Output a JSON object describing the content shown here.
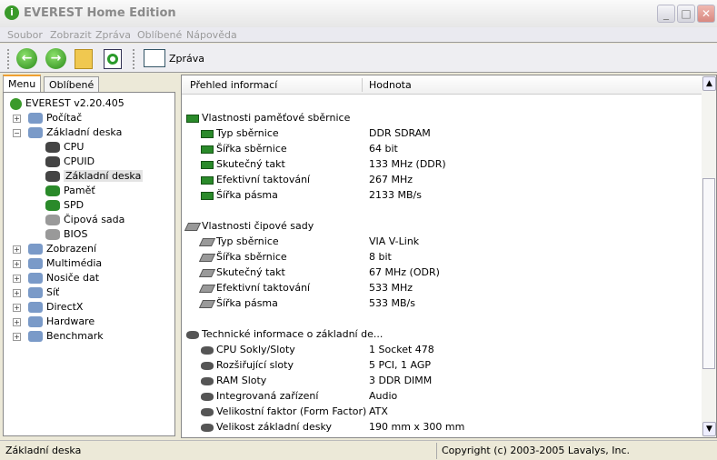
{
  "window": {
    "title": "EVEREST Home Edition",
    "minimize": "_",
    "maximize": "□",
    "close": "✕"
  },
  "menu": [
    "Soubor",
    "Zobrazit",
    "Zpráva",
    "Oblíbené",
    "Nápověda"
  ],
  "toolbar": {
    "back": "←",
    "forward": "→",
    "report_label": "Zpráva"
  },
  "tabs": [
    "Menu",
    "Oblíbené"
  ],
  "tree": {
    "root": "EVEREST v2.20.405",
    "items": [
      {
        "label": "Počítač",
        "level": 1,
        "exp": "+"
      },
      {
        "label": "Základní deska",
        "level": 1,
        "exp": "−"
      },
      {
        "label": "CPU",
        "level": 2
      },
      {
        "label": "CPUID",
        "level": 2
      },
      {
        "label": "Základní deska",
        "level": 2,
        "selected": true
      },
      {
        "label": "Paměť",
        "level": 2
      },
      {
        "label": "SPD",
        "level": 2
      },
      {
        "label": "Čipová sada",
        "level": 2
      },
      {
        "label": "BIOS",
        "level": 2
      },
      {
        "label": "Zobrazení",
        "level": 1,
        "exp": "+"
      },
      {
        "label": "Multimédia",
        "level": 1,
        "exp": "+"
      },
      {
        "label": "Nosiče dat",
        "level": 1,
        "exp": "+"
      },
      {
        "label": "Síť",
        "level": 1,
        "exp": "+"
      },
      {
        "label": "DirectX",
        "level": 1,
        "exp": "+"
      },
      {
        "label": "Hardware",
        "level": 1,
        "exp": "+"
      },
      {
        "label": "Benchmark",
        "level": 1,
        "exp": "+"
      }
    ]
  },
  "columns": [
    "Přehled informací",
    "Hodnota"
  ],
  "groups": [
    {
      "title": "Vlastnosti paměťové sběrnice",
      "icon": "mem",
      "rows": [
        [
          "Typ sběrnice",
          "DDR SDRAM"
        ],
        [
          "Šířka sběrnice",
          "64 bit"
        ],
        [
          "Skutečný takt",
          "133 MHz (DDR)"
        ],
        [
          "Efektivní taktování",
          "267 MHz"
        ],
        [
          "Šířka pásma",
          "2133 MB/s"
        ]
      ]
    },
    {
      "title": "Vlastnosti čipové sady",
      "icon": "chip",
      "rows": [
        [
          "Typ sběrnice",
          "VIA V-Link"
        ],
        [
          "Šířka sběrnice",
          "8 bit"
        ],
        [
          "Skutečný takt",
          "67 MHz (ODR)"
        ],
        [
          "Efektivní taktování",
          "533 MHz"
        ],
        [
          "Šířka pásma",
          "533 MB/s"
        ]
      ]
    },
    {
      "title": "Technické informace o základní de...",
      "icon": "board",
      "rows": [
        [
          "CPU Sokly/Sloty",
          "1 Socket 478"
        ],
        [
          "Rozšiřující sloty",
          "5 PCI, 1 AGP"
        ],
        [
          "RAM Sloty",
          "3 DDR DIMM"
        ],
        [
          "Integrovaná zařízení",
          "Audio"
        ],
        [
          "Velikostní faktor (Form Factor)",
          "ATX"
        ],
        [
          "Velikost základní desky",
          "190 mm x 300 mm"
        ]
      ]
    }
  ],
  "status": {
    "left": "Základní deska",
    "right": "Copyright (c) 2003-2005 Lavalys, Inc."
  }
}
